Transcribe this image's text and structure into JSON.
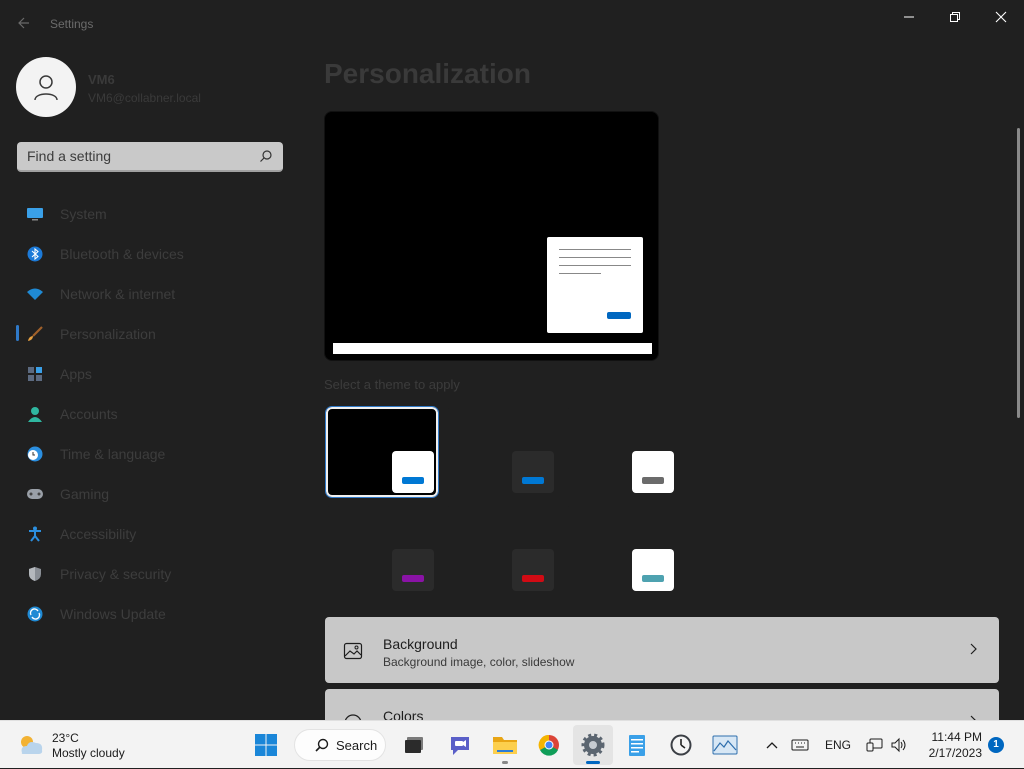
{
  "window": {
    "title": "Settings",
    "controls": {
      "minimize": "minimize",
      "restore": "restore",
      "close": "close"
    }
  },
  "profile": {
    "name": "VM6",
    "email": "VM6@collabner.local"
  },
  "search": {
    "placeholder": "Find a setting",
    "value": ""
  },
  "nav": {
    "selected": "Personalization",
    "items": [
      {
        "label": "System",
        "icon": "monitor-icon"
      },
      {
        "label": "Bluetooth & devices",
        "icon": "bluetooth-icon"
      },
      {
        "label": "Network & internet",
        "icon": "wifi-icon"
      },
      {
        "label": "Personalization",
        "icon": "brush-icon"
      },
      {
        "label": "Apps",
        "icon": "apps-icon"
      },
      {
        "label": "Accounts",
        "icon": "person-icon"
      },
      {
        "label": "Time & language",
        "icon": "clock-globe-icon"
      },
      {
        "label": "Gaming",
        "icon": "gamepad-icon"
      },
      {
        "label": "Accessibility",
        "icon": "accessibility-icon"
      },
      {
        "label": "Privacy & security",
        "icon": "shield-icon"
      },
      {
        "label": "Windows Update",
        "icon": "update-icon"
      }
    ]
  },
  "main": {
    "title": "Personalization",
    "themes_label": "Select a theme to apply",
    "themes": [
      {
        "bg": "#000000",
        "chip": "#ffffff",
        "accent": "#0078d4",
        "selected": true
      },
      {
        "bg": "#202020",
        "chip": "#2b2b2b",
        "accent": "#0078d4",
        "selected": false
      },
      {
        "bg": "#202020",
        "chip": "#ffffff",
        "accent": "#6b6b6b",
        "selected": false
      },
      {
        "bg": "#202020",
        "chip": "#2b2b2b",
        "accent": "#8a13a6",
        "selected": false
      },
      {
        "bg": "#202020",
        "chip": "#2b2b2b",
        "accent": "#d10b14",
        "selected": false
      },
      {
        "bg": "#202020",
        "chip": "#ffffff",
        "accent": "#4ea2b0",
        "selected": false
      }
    ],
    "cards": [
      {
        "title": "Background",
        "subtitle": "Background image, color, slideshow",
        "icon": "image-icon"
      },
      {
        "title": "Colors",
        "subtitle": "",
        "icon": "palette-icon"
      }
    ]
  },
  "taskbar": {
    "weather": {
      "temp": "23°C",
      "desc": "Mostly cloudy"
    },
    "search_label": "Search",
    "apps": [
      "start-icon",
      "task-view-icon",
      "teams-chat-icon",
      "file-explorer-icon",
      "chrome-icon",
      "settings-icon",
      "notepad-icon",
      "clock-app-icon",
      "photos-icon"
    ],
    "tray": {
      "language": "ENG"
    },
    "clock": {
      "time": "11:44 PM",
      "date": "2/17/2023"
    },
    "notifications": "1"
  },
  "colors": {
    "accent": "#0067c0",
    "window_bg": "#202020",
    "taskbar_bg": "#f3f3f3"
  }
}
